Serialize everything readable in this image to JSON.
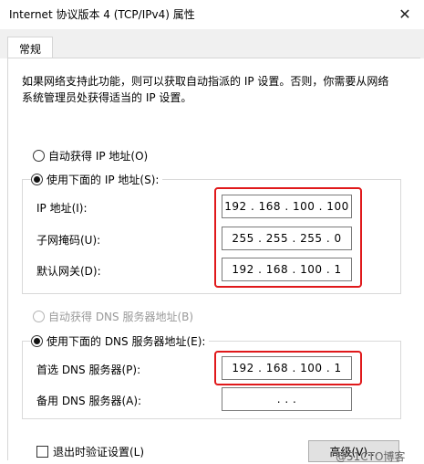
{
  "window": {
    "title": "Internet 协议版本 4 (TCP/IPv4) 属性",
    "close_glyph": "✕"
  },
  "tabs": [
    {
      "label": "常规"
    }
  ],
  "description": "如果网络支持此功能，则可以获取自动指派的 IP 设置。否则，你需要从网络系统管理员处获得适当的 IP 设置。",
  "ip": {
    "auto_label": "自动获得 IP 地址(O)",
    "manual_label": "使用下面的 IP 地址(S):",
    "address_label": "IP 地址(I):",
    "address_value": "192 . 168 . 100 . 100",
    "mask_label": "子网掩码(U):",
    "mask_value": "255 . 255 . 255 .  0",
    "gateway_label": "默认网关(D):",
    "gateway_value": "192 . 168 . 100 .  1"
  },
  "dns": {
    "auto_label": "自动获得 DNS 服务器地址(B)",
    "manual_label": "使用下面的 DNS 服务器地址(E):",
    "preferred_label": "首选 DNS 服务器(P):",
    "preferred_value": "192 . 168 . 100 .  1",
    "alternate_label": "备用 DNS 服务器(A):",
    "alternate_value": ".       .       ."
  },
  "validate_label": "退出时验证设置(L)",
  "advanced_button": "高级(V)...",
  "watermark": "@51CTO博客",
  "colors": {
    "highlight": "#e0191b"
  }
}
